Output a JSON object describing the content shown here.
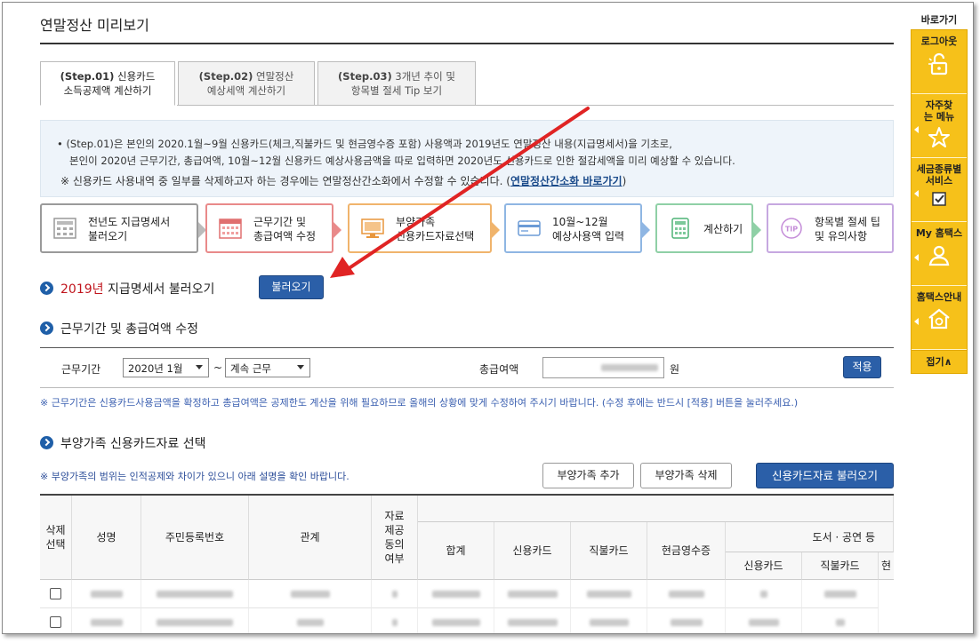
{
  "page": {
    "title": "연말정산 미리보기"
  },
  "tabs": [
    {
      "step": "(Step.01)",
      "label1": "신용카드",
      "label2": "소득공제액 계산하기"
    },
    {
      "step": "(Step.02)",
      "label1": "연말정산",
      "label2": "예상세액 계산하기"
    },
    {
      "step": "(Step.03)",
      "label1": "3개년 추이 및",
      "label2": "항목별 절세 Tip 보기"
    }
  ],
  "info": {
    "line1": "• (Step.01)은 본인의 2020.1월~9월 신용카드(체크,직불카드 및 현금영수증 포함) 사용액과 2019년도 연말정산 내용(지급명세서)을 기초로,",
    "line2": "본인이 2020년 근무기간, 총급여액, 10월~12월 신용카드 예상사용금액을 따로 입력하면 2020년도 신용카드로 인한 절감세액을 미리 예상할 수 있습니다.",
    "line3": "※ 신용카드 사용내역 중 일부를 삭제하고자 하는 경우에는 연말정산간소화에서 수정할 수 있습니다. (",
    "link": "연말정산간소화 바로가기",
    "line3_end": ")"
  },
  "steps": [
    {
      "l1": "전년도 지급명세서",
      "l2": "불러오기",
      "icon": "calculator-doc-icon",
      "color": "#9a9a9a"
    },
    {
      "l1": "근무기간 및",
      "l2": "총급여액 수정",
      "icon": "calendar-icon",
      "color": "#e98a8a"
    },
    {
      "l1": "부양가족",
      "l2": "신용카드자료선택",
      "icon": "monitor-icon",
      "color": "#f0b46c"
    },
    {
      "l1": "10월~12월",
      "l2": "예상사용액 입력",
      "icon": "credit-card-icon",
      "color": "#8fb6e3"
    },
    {
      "l1": "계산하기",
      "l2": "",
      "icon": "calculator-icon",
      "color": "#8fd0a6"
    },
    {
      "l1": "항목별 절세 팁",
      "l2": "및 유의사항",
      "icon": "tip-icon",
      "color": "#c6a8e0"
    }
  ],
  "section1": {
    "year": "2019년",
    "title": " 지급명세서 불러오기",
    "button": "불러오기"
  },
  "section2": {
    "title": "근무기간 및 총급여액 수정",
    "period_label": "근무기간",
    "start_month": "2020년 1월",
    "tilde": "~",
    "end_option": "계속 근무",
    "salary_label": "총급여액",
    "salary_unit": "원",
    "apply": "적용",
    "note": "※ 근무기간은 신용카드사용금액을 확정하고 총급여액은 공제한도 계산을 위해 필요하므로 올해의 상황에 맞게 수정하여 주시기 바랍니다. (수정 후에는 반드시 [적용] 버튼을 눌러주세요.)"
  },
  "section3": {
    "title": "부양가족 신용카드자료 선택",
    "note": "※ 부양가족의 범위는 인적공제와 차이가 있으니 아래 설명을 확인 바랍니다.",
    "add": "부양가족 추가",
    "delete": "부양가족 삭제",
    "load": "신용카드자료 불러오기"
  },
  "table": {
    "headers": {
      "select": "삭제\n선택",
      "name": "성명",
      "rrn": "주민등록번호",
      "relation": "관계",
      "consent": "자료\n제공\n동의\n여부",
      "total": "합계",
      "credit": "신용카드",
      "debit": "직불카드",
      "cash": "현금영수증",
      "culture": "도서 · 공연 등",
      "c_credit": "신용카드",
      "c_debit": "직불카드",
      "c_more": "현"
    }
  },
  "sidebar": {
    "title": "바로가기",
    "items": [
      {
        "label": "로그아웃",
        "icon": "unlock-icon"
      },
      {
        "label": "자주찾는 메뉴",
        "icon": "star-icon"
      },
      {
        "label": "세금종류별 서비스",
        "icon": "checkbox-icon"
      },
      {
        "label": "My 홈택스",
        "icon": "user-icon"
      },
      {
        "label": "홈택스안내",
        "icon": "home-info-icon"
      }
    ],
    "close": "접기∧"
  }
}
